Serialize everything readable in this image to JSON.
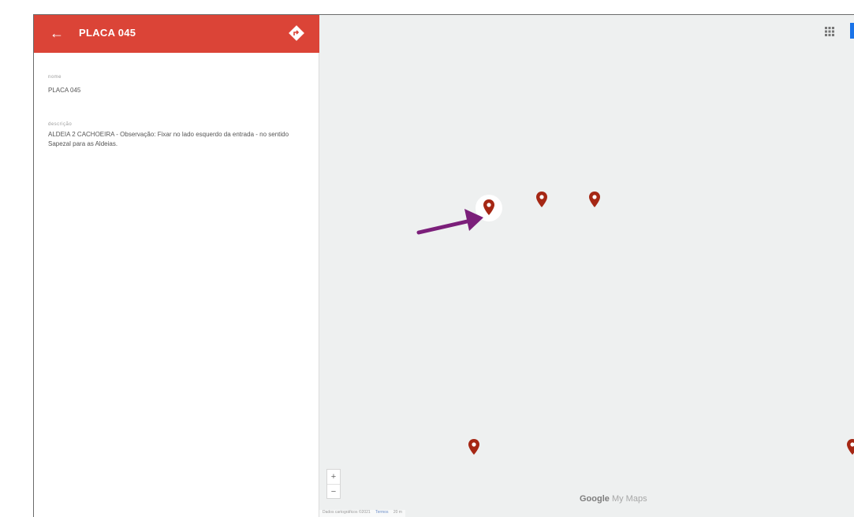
{
  "panel": {
    "title": "PLACA 045",
    "back_icon": "arrow-left-icon",
    "directions_icon": "directions-icon",
    "header_color": "#db4437",
    "fields": {
      "name_label": "nome",
      "name_value": "PLACA 045",
      "description_label": "descrição",
      "description_value": "ALDEIA 2 CACHOEIRA - Observação: Fixar no lado esquerdo da entrada - no sentido Sapezal para as Aldeias."
    }
  },
  "map": {
    "background_color": "#eef0f0",
    "pin_color": "#a52714",
    "pin_count": 5,
    "selected_pin": "pin-1",
    "grid_icon": "grid-icon",
    "annotation_arrow_color": "#7b1f7a",
    "zoom": {
      "in_label": "+",
      "out_label": "−"
    },
    "logo": {
      "google": "Google",
      "rest": "My Maps"
    },
    "attribution": {
      "text": "Dados cartográficos ©2021",
      "terms": "Termos",
      "scale": "20 m"
    }
  }
}
